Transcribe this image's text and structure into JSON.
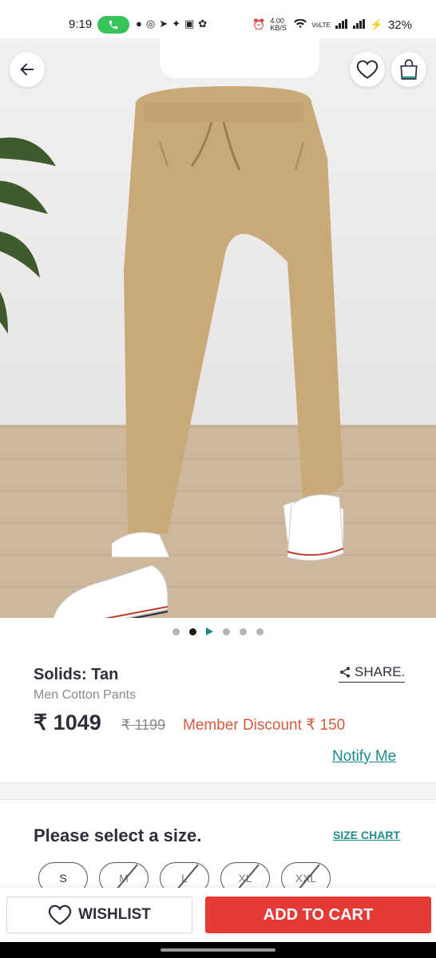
{
  "status_bar": {
    "time": "9:19",
    "call_icon": "phone-icon",
    "net_speed": "4.00 KB/S",
    "carrier": "VoLTE",
    "battery": "32%"
  },
  "header": {
    "back_icon": "arrow-left-icon",
    "wishlist_icon": "heart-icon",
    "bag_icon": "shopping-bag-icon"
  },
  "gallery": {
    "dots": [
      {
        "state": "inactive"
      },
      {
        "state": "active"
      },
      {
        "state": "video"
      },
      {
        "state": "inactive"
      },
      {
        "state": "inactive"
      },
      {
        "state": "inactive"
      }
    ]
  },
  "product": {
    "title": "Solids: Tan",
    "subtitle": "Men Cotton Pants",
    "share_label": "SHARE.",
    "price": "₹ 1049",
    "mrp": "₹ 1199",
    "member_discount": "Member Discount ₹ 150",
    "notify_label": "Notify Me"
  },
  "size_section": {
    "prompt": "Please select a size.",
    "size_chart_label": "SIZE CHART",
    "sizes": [
      {
        "label": "S",
        "available": true
      },
      {
        "label": "M",
        "available": false
      },
      {
        "label": "L",
        "available": false
      },
      {
        "label": "XL",
        "available": false
      },
      {
        "label": "XXL",
        "available": false
      }
    ]
  },
  "actions": {
    "wishlist_label": "WISHLIST",
    "add_to_cart_label": "ADD TO CART"
  },
  "colors": {
    "accent_teal": "#1d8c8c",
    "cta_red": "#e53a36",
    "discount_red": "#d35a3d",
    "text_dark": "#2e2e3a",
    "pants_tan": "#c9a87a"
  }
}
